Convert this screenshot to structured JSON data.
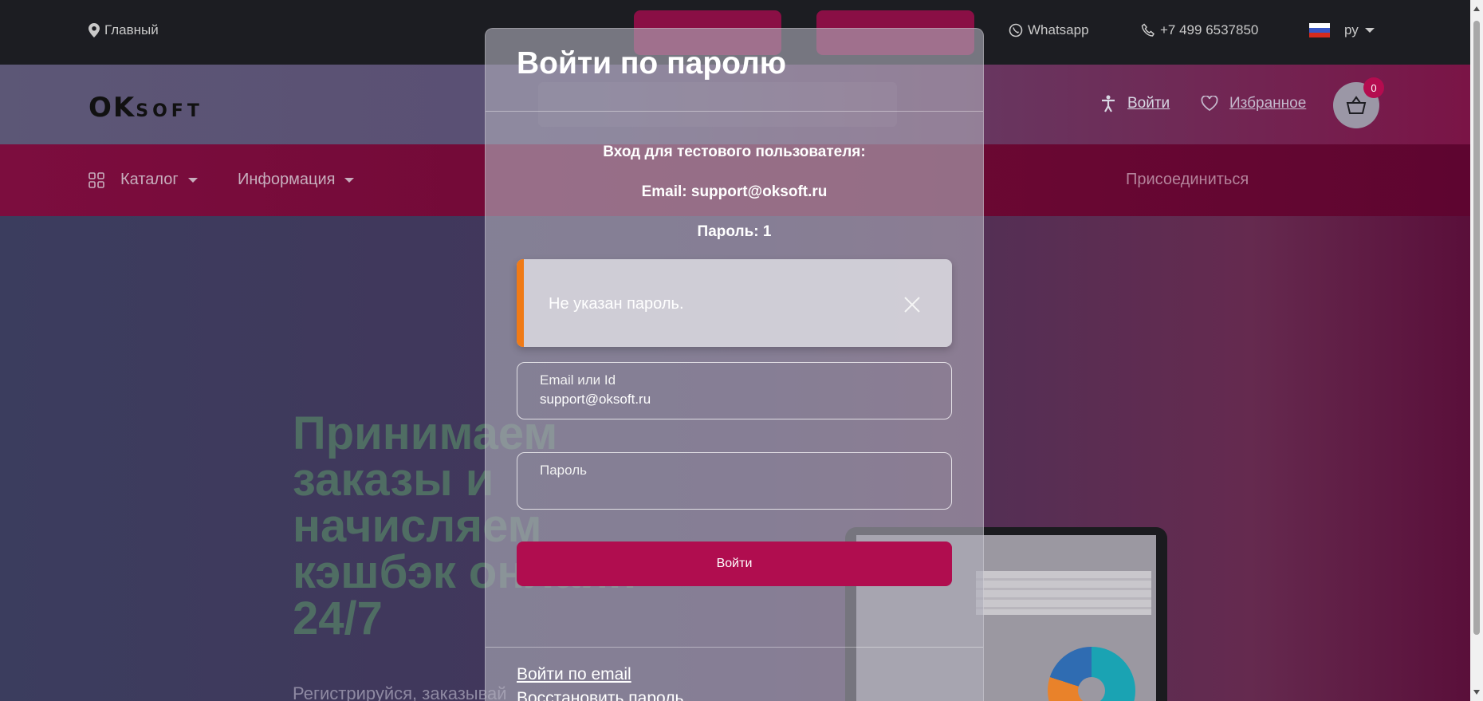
{
  "topbar": {
    "location": "Главный",
    "whatsapp": "Whatsapp",
    "phone": "+7 499 6537850",
    "language": "ру"
  },
  "header": {
    "logo_big": "OK",
    "logo_small": "SOFT",
    "login": "Войти",
    "favorites": "Избранное",
    "cart_count": "0"
  },
  "nav": {
    "catalog": "Каталог",
    "info": "Информация",
    "join": "Присоединиться"
  },
  "hero": {
    "title_lines": [
      "Принимаем",
      "заказы и",
      "начисляем",
      "кэшбэк онлайн",
      "24/7"
    ],
    "subtitle": "Регистрируйся, заказывай"
  },
  "modal": {
    "title": "Войти по паролю",
    "test_user_heading": "Вход для тестового пользователя:",
    "test_email": "Email: support@oksoft.ru",
    "test_password": "Пароль: 1",
    "alert_message": "Не указан пароль.",
    "email_label": "Email или Id",
    "email_value": "support@oksoft.ru",
    "password_label": "Пароль",
    "password_value": "",
    "submit": "Войти",
    "link_email": "Войти по email",
    "link_restore": "Восстановить пароль"
  },
  "colors": {
    "accent": "#b00d4f",
    "alert_bar": "#f07a16",
    "topbar_bg": "#1c1d22"
  }
}
